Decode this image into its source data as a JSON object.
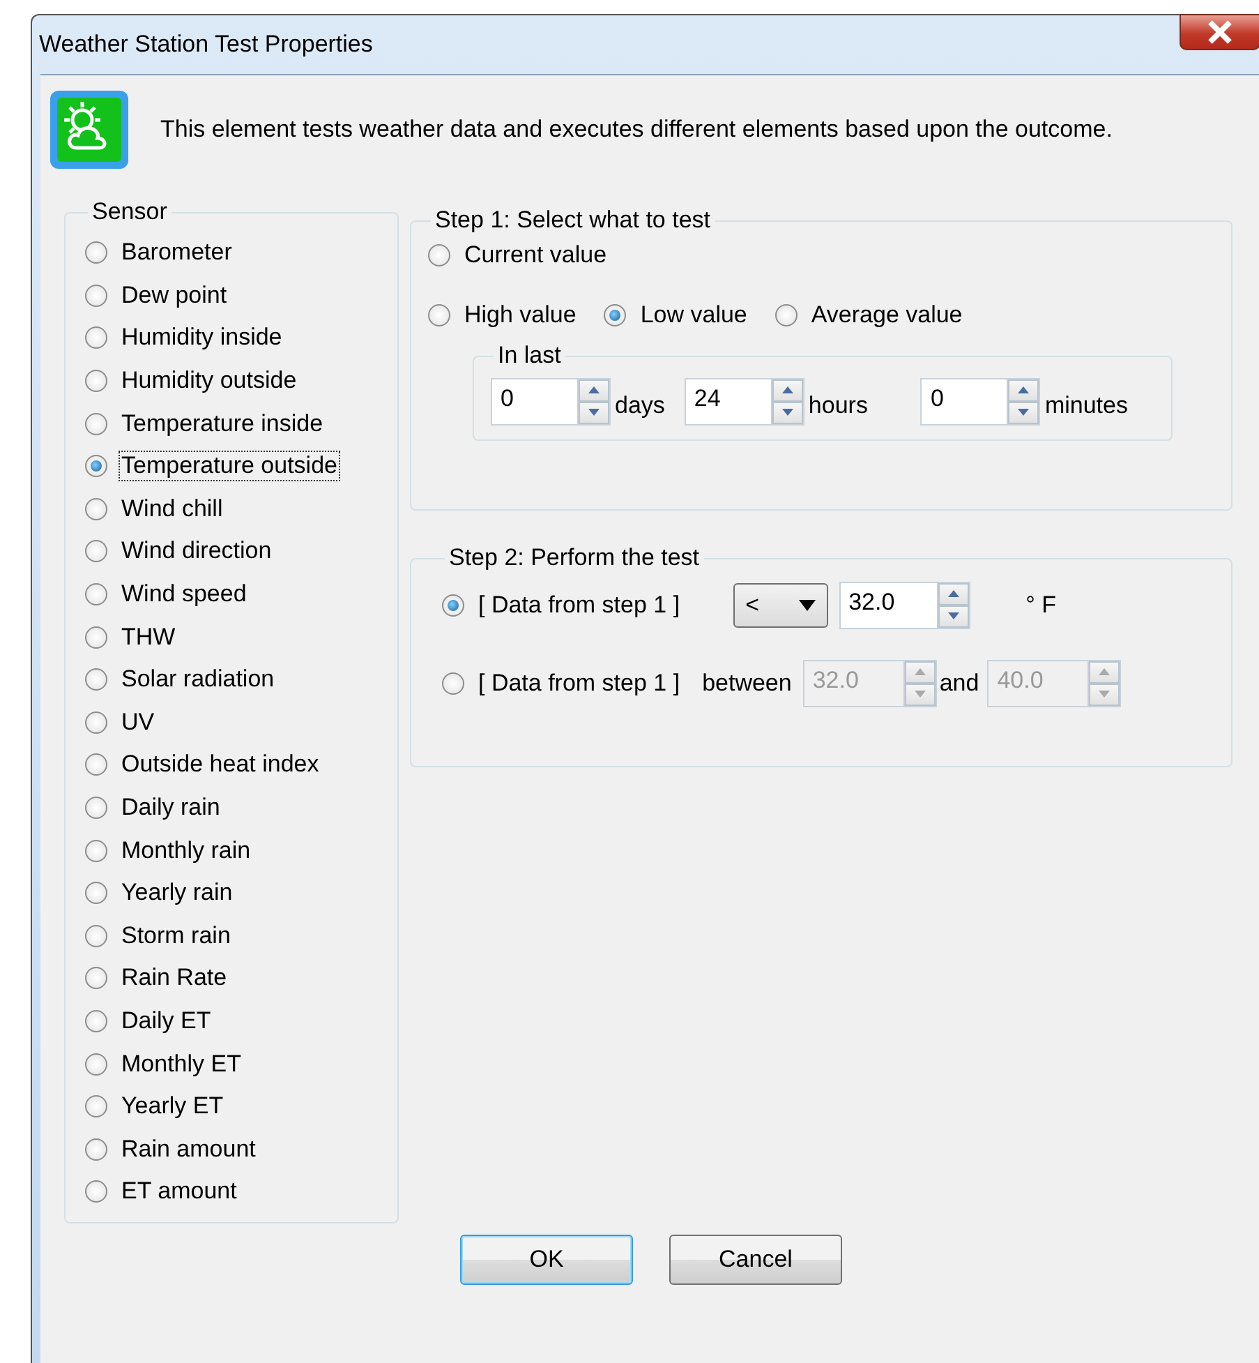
{
  "window": {
    "title": "Weather Station Test Properties"
  },
  "description": "This element tests weather data and executes different elements based upon the outcome.",
  "sensor": {
    "title": "Sensor",
    "items": [
      {
        "label": "Barometer",
        "selected": false
      },
      {
        "label": "Dew point",
        "selected": false
      },
      {
        "label": "Humidity inside",
        "selected": false
      },
      {
        "label": "Humidity outside",
        "selected": false
      },
      {
        "label": "Temperature inside",
        "selected": false
      },
      {
        "label": "Temperature outside",
        "selected": true
      },
      {
        "label": "Wind chill",
        "selected": false
      },
      {
        "label": "Wind direction",
        "selected": false
      },
      {
        "label": "Wind speed",
        "selected": false
      },
      {
        "label": "THW",
        "selected": false
      },
      {
        "label": "Solar radiation",
        "selected": false
      },
      {
        "label": "UV",
        "selected": false
      },
      {
        "label": "Outside heat index",
        "selected": false
      },
      {
        "label": "Daily rain",
        "selected": false
      },
      {
        "label": "Monthly rain",
        "selected": false
      },
      {
        "label": "Yearly rain",
        "selected": false
      },
      {
        "label": "Storm rain",
        "selected": false
      },
      {
        "label": "Rain Rate",
        "selected": false
      },
      {
        "label": "Daily ET",
        "selected": false
      },
      {
        "label": "Monthly ET",
        "selected": false
      },
      {
        "label": "Yearly ET",
        "selected": false
      },
      {
        "label": "Rain amount",
        "selected": false
      },
      {
        "label": "ET amount",
        "selected": false
      }
    ]
  },
  "step1": {
    "title": "Step 1: Select what to test",
    "options": [
      {
        "label": "Current value",
        "selected": false
      },
      {
        "label": "High value",
        "selected": false
      },
      {
        "label": "Low value",
        "selected": true
      },
      {
        "label": "Average value",
        "selected": false
      }
    ],
    "in_last": {
      "title": "In last",
      "fields": [
        {
          "value": "0",
          "unit": "days"
        },
        {
          "value": "24",
          "unit": "hours"
        },
        {
          "value": "0",
          "unit": "minutes"
        }
      ]
    }
  },
  "step2": {
    "title": "Step 2: Perform the test",
    "compare": {
      "label": "[ Data from step 1 ]",
      "selected": true,
      "operator": "<",
      "value": "32.0",
      "unit": "° F",
      "disabled": false
    },
    "range": {
      "label": "[ Data from step 1 ]",
      "selected": false,
      "between": "between",
      "low": "32.0",
      "and": "and",
      "high": "40.0",
      "disabled": true
    }
  },
  "buttons": [
    {
      "label": "OK",
      "default": true
    },
    {
      "label": "Cancel",
      "default": false
    }
  ]
}
